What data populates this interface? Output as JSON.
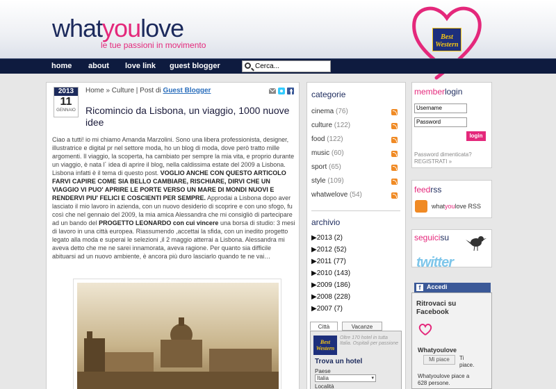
{
  "header": {
    "logo_pre": "what",
    "logo_you": "you",
    "logo_post": "love",
    "tagline": "le tue passioni in movimento",
    "sponsor_line1": "Best",
    "sponsor_line2": "Western"
  },
  "nav": {
    "items": [
      "home",
      "about",
      "love link",
      "guest blogger"
    ],
    "search_placeholder": "Cerca..."
  },
  "post": {
    "year": "2013",
    "day": "11",
    "month": "GENNAIO",
    "breadcrumb_pre": "Home » Culture | Post di ",
    "breadcrumb_author": "Guest Blogger",
    "title": "Ricomincio da Lisbona, un viaggio, 1000 nuove idee",
    "body_1": "Ciao a tutti! io mi chiamo Amanda Marzolini. Sono una libera professionista, designer, illustratrice e digital pr nel settore moda, ho un blog di moda, dove però tratto mille argomenti. Il viaggio, la scoperta, ha cambiato per sempre la mia vita, e proprio durante un viaggio, è nata l´ idea di aprire il blog, nella caldissima estate del 2009 a Lisbona. Lisbona infatti è il tema di questo post. ",
    "body_bold_1": "VOGLIO ANCHE CON QUESTO ARTICOLO FARVI CAPIRE COME SIA BELLO CAMBIARE, RISCHIARE, DIRVI CHE UN VIAGGIO VI PUO' APRIRE LE PORTE VERSO UN MARE DI MONDI NUOVI E RENDERVI PIU' FELICI E COSCIENTI PER SEMPRE.",
    "body_2": " Approdai a Lisbona dopo aver lasciato il mio lavoro in azienda, con un nuovo desiderio di scoprire e con uno sfogo, fu così che nel gennaio del 2009, la mia amica Alessandra che mi consigliò di partecipare ad un bando del ",
    "body_bold_2": "PROGETTO LEONARDO con cui vincere",
    "body_3": " una borsa di studio: 3 mesi di lavoro in una città europea. Riassumendo ,accettai la sfida, con un inedito progetto legato alla moda e superai le selezioni ,il 2 maggio atterrai a Lisbona. Alessandra mi aveva detto che me ne sarei innamorata, aveva ragione. Per quanto sia difficile abituarsi ad un nuovo ambiente, è ancora più duro lasciarlo quando te ne vai…"
  },
  "categories": {
    "title": "categorie",
    "items": [
      {
        "name": "cinema",
        "count": "(76)"
      },
      {
        "name": "culture",
        "count": "(122)"
      },
      {
        "name": "food",
        "count": "(122)"
      },
      {
        "name": "music",
        "count": "(60)"
      },
      {
        "name": "sport",
        "count": "(65)"
      },
      {
        "name": "style",
        "count": "(109)"
      },
      {
        "name": "whatwelove",
        "count": "(54)"
      }
    ]
  },
  "archive": {
    "title": "archivio",
    "items": [
      {
        "year": "▶2013",
        "count": "(2)"
      },
      {
        "year": "▶2012",
        "count": "(52)"
      },
      {
        "year": "▶2011",
        "count": "(77)"
      },
      {
        "year": "▶2010",
        "count": "(143)"
      },
      {
        "year": "▶2009",
        "count": "(186)"
      },
      {
        "year": "▶2008",
        "count": "(228)"
      },
      {
        "year": "▶2007",
        "count": "(7)"
      }
    ]
  },
  "hotel": {
    "tab_city": "Città",
    "tab_holiday": "Vacanze",
    "logo_line1": "Best",
    "logo_line2": "Western",
    "tagline": "Oltre 170 hotel in tutta Italia. Ospitali per passione",
    "title": "Trova un hotel",
    "country_label": "Paese",
    "country_value": "Italia",
    "city_label": "Località"
  },
  "member": {
    "title_a": "member",
    "title_b": "login",
    "username_placeholder": "Username",
    "password_placeholder": "Password",
    "login_label": "login",
    "forgot": "Password dimenticata?",
    "register": "REGISTRATI »"
  },
  "feed": {
    "title_a": "feed",
    "title_b": "rss",
    "label_pre": "what",
    "label_you": "you",
    "label_post": "love RSS"
  },
  "follow": {
    "title_a": "seguici",
    "title_b": "su",
    "twitter": "twitter"
  },
  "facebook": {
    "accedi": "Accedi",
    "title_1": "Ritrovaci su",
    "title_2": "Facebook",
    "page_name": "Whatyoulove",
    "like_button": "Mi piace",
    "like_text_1": "Ti",
    "like_text_2": "piace.",
    "count_1": "Whatyoulove piace a",
    "count_2": "628 persone."
  },
  "colors": {
    "brand_pink": "#e4287b",
    "brand_navy": "#1c2a5c",
    "nav_bg": "#0e1b3f",
    "facebook_blue": "#3b5998",
    "rss_orange": "#f08a24"
  }
}
